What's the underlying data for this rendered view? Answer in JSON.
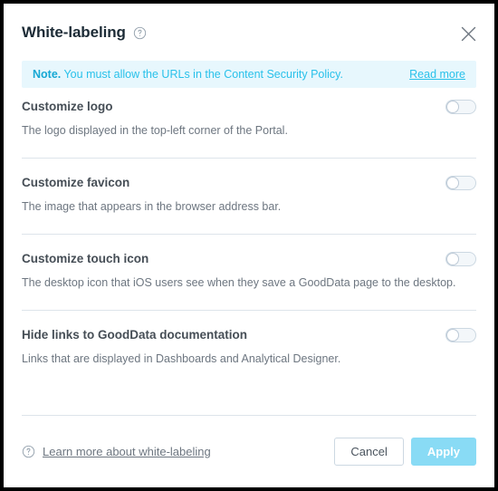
{
  "dialog": {
    "title": "White-labeling",
    "help_icon": "question-circle-icon",
    "close_icon": "close-icon"
  },
  "note": {
    "label": "Note.",
    "text": " You must allow the URLs in the Content Security Policy.",
    "link": "Read more",
    "background_color": "#e7f7fd",
    "text_color": "#29c1ea"
  },
  "settings": [
    {
      "title": "Customize logo",
      "description": "The logo displayed in the top-left corner of the Portal.",
      "toggle_state": "off"
    },
    {
      "title": "Customize favicon",
      "description": "The image that appears in the browser address bar.",
      "toggle_state": "off"
    },
    {
      "title": "Customize touch icon",
      "description": "The desktop icon that iOS users see when they save a GoodData page to the desktop.",
      "toggle_state": "off"
    },
    {
      "title": "Hide links to GoodData documentation",
      "description": "Links that are displayed in Dashboards and Analytical Designer.",
      "toggle_state": "off"
    }
  ],
  "footer": {
    "help_icon": "question-circle-icon",
    "link": "Learn more about white-labeling",
    "cancel_label": "Cancel",
    "apply_label": "Apply",
    "apply_color": "#89dbf5"
  }
}
